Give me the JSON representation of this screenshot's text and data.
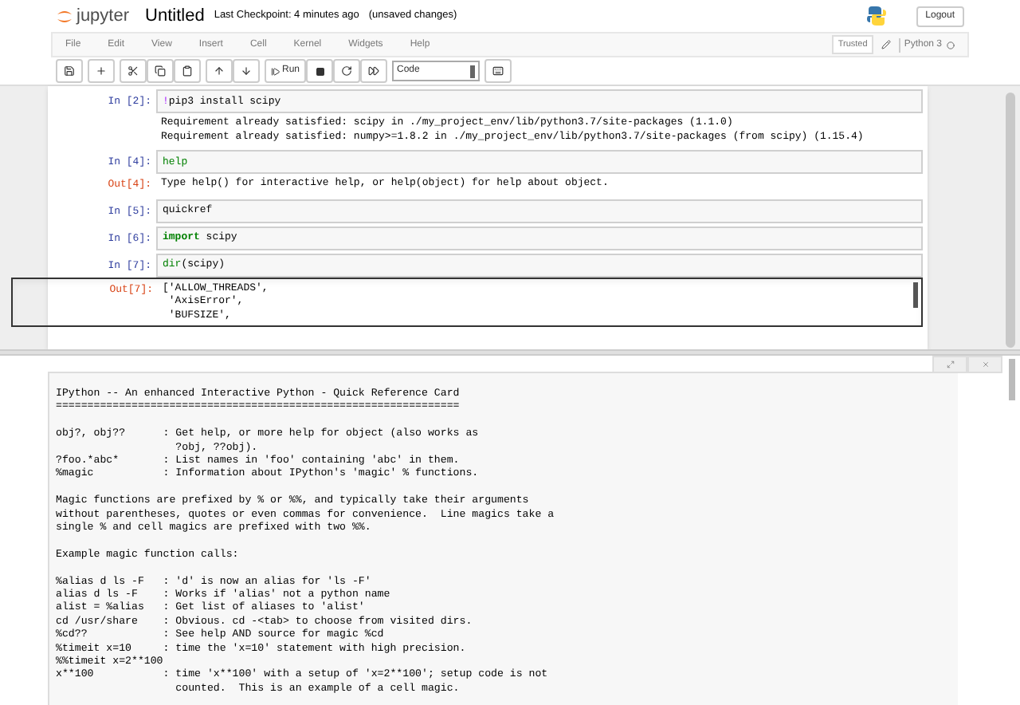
{
  "header": {
    "logo_text": "jupyter",
    "title": "Untitled",
    "checkpoint": "Last Checkpoint: 4 minutes ago",
    "status": "(unsaved changes)",
    "logout": "Logout"
  },
  "menu": [
    "File",
    "Edit",
    "View",
    "Insert",
    "Cell",
    "Kernel",
    "Widgets",
    "Help"
  ],
  "trusted": "Trusted",
  "kernel": "Python 3",
  "toolbar": {
    "run": "Run",
    "cell_type": "Code"
  },
  "cells": [
    {
      "prompt": "In [2]:",
      "source": [
        {
          "kind": "magic",
          "text": "!"
        },
        {
          "kind": "plain",
          "text": "pip3 install scipy"
        }
      ],
      "output": [
        "Requirement already satisfied: scipy in ./my_project_env/lib/python3.7/site-packages (1.1.0)",
        "Requirement already satisfied: numpy>=1.8.2 in ./my_project_env/lib/python3.7/site-packages (from scipy) (1.15.4)"
      ]
    },
    {
      "prompt": "In [4]:",
      "source": [
        {
          "kind": "builtin",
          "text": "help"
        }
      ],
      "out_prompt": "Out[4]:",
      "output": [
        "Type help() for interactive help, or help(object) for help about object."
      ]
    },
    {
      "prompt": "In [5]:",
      "source": [
        {
          "kind": "plain",
          "text": "quickref"
        }
      ]
    },
    {
      "prompt": "In [6]:",
      "source": [
        {
          "kind": "keyword",
          "text": "import"
        },
        {
          "kind": "plain",
          "text": " scipy"
        }
      ]
    },
    {
      "prompt": "In [7]:",
      "source": [
        {
          "kind": "builtin",
          "text": "dir"
        },
        {
          "kind": "plain",
          "text": "(scipy)"
        }
      ],
      "out_prompt": "Out[7]:",
      "scrolled": true,
      "output": [
        "['ALLOW_THREADS',",
        " 'AxisError',",
        " 'BUFSIZE',"
      ]
    }
  ],
  "pager": {
    "blocks": [
      [
        "IPython -- An enhanced Interactive Python - Quick Reference Card",
        "================================================================"
      ],
      [
        "obj?, obj??      : Get help, or more help for object (also works as",
        "                   ?obj, ??obj).",
        "?foo.*abc*       : List names in 'foo' containing 'abc' in them.",
        "%magic           : Information about IPython's 'magic' % functions."
      ],
      [
        "Magic functions are prefixed by % or %%, and typically take their arguments",
        "without parentheses, quotes or even commas for convenience.  Line magics take a",
        "single % and cell magics are prefixed with two %%."
      ],
      [
        "Example magic function calls:"
      ],
      [
        "%alias d ls -F   : 'd' is now an alias for 'ls -F'",
        "alias d ls -F    : Works if 'alias' not a python name",
        "alist = %alias   : Get list of aliases to 'alist'",
        "cd /usr/share    : Obvious. cd -<tab> to choose from visited dirs.",
        "%cd??            : See help AND source for magic %cd",
        "%timeit x=10     : time the 'x=10' statement with high precision.",
        "%%timeit x=2**100",
        "x**100           : time 'x**100' with a setup of 'x=2**100'; setup code is not",
        "                   counted.  This is an example of a cell magic."
      ]
    ]
  }
}
